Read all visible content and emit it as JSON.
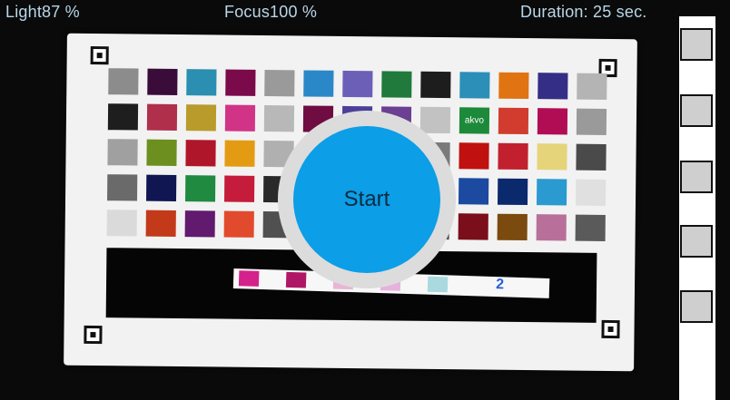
{
  "status": {
    "light": "Light87 %",
    "focus": "Focus100 %",
    "duration": "Duration: 25 sec."
  },
  "preview": {
    "swatch_colors": [
      [
        "#8c8c8c",
        "#3a0c3a",
        "#2a8fb0",
        "#7a0a49",
        "#9a9a9a",
        "#2a88c8",
        "#6b5fb8",
        "#1f7a3c",
        "#1d1d1d",
        "#2b8fb8",
        "#e07412",
        "#352e86",
        "#b4b4b4"
      ],
      [
        "#1e1e1e",
        "#b02f4a",
        "#b89b2a",
        "#d13487",
        "#b8b8b8",
        "#6f0d43",
        "#4b3f99",
        "#6b3f92",
        "#c2c2c2",
        "#1c8a3a",
        "#d13c2e",
        "#b10d55",
        "#9a9a9a"
      ],
      [
        "#a0a0a0",
        "#6d8f1f",
        "#b01629",
        "#e49b14",
        "#b0b0b0",
        "#2b2b2b",
        "#3d4c9e",
        "#bcbcbc",
        "#7a7a7a",
        "#c01010",
        "#c2202e",
        "#e6d47a",
        "#4a4a4a"
      ],
      [
        "#6a6a6a",
        "#0f1652",
        "#1f8a40",
        "#c41c3a",
        "#2a2a2a",
        "#1e7aa8",
        "#1d2f7a",
        "#d0d0d0",
        "#a8a8a8",
        "#1b4aa0",
        "#0b2a6e",
        "#2b9ad0",
        "#e0e0e0"
      ],
      [
        "#dadada",
        "#c23a1a",
        "#611a6e",
        "#e24a2e",
        "#505050",
        "#b0b0b0",
        "#f0a9a9",
        "#7a7a7a",
        "#4a4a4a",
        "#7a0e1a",
        "#7a4a0e",
        "#b8709a",
        "#5a5a5a"
      ]
    ],
    "akvo_label": "akvo",
    "strip_label": "2",
    "pad_colors": [
      "#d5218b",
      "#b01666",
      "#e9b5d2",
      "#e7b1dd",
      "#aad9e0"
    ]
  },
  "start_button": {
    "label": "Start",
    "color": "#0c9ee6"
  },
  "sidebar": {
    "slot_count": 5
  }
}
